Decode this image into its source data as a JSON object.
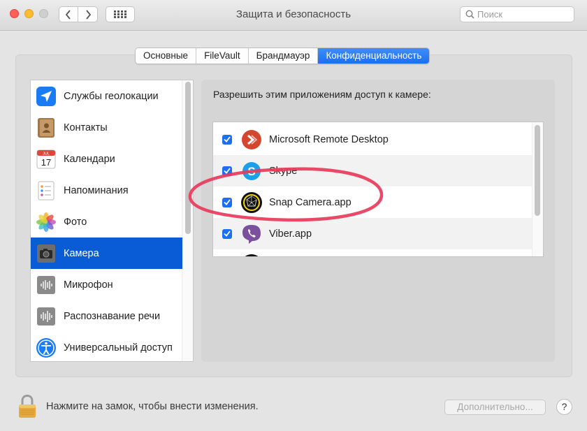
{
  "window": {
    "title": "Защита и безопасность"
  },
  "search": {
    "placeholder": "Поиск"
  },
  "tabs": [
    {
      "label": "Основные",
      "active": false
    },
    {
      "label": "FileVault",
      "active": false
    },
    {
      "label": "Брандмауэр",
      "active": false
    },
    {
      "label": "Конфиденциальность",
      "active": true
    }
  ],
  "sidebar": {
    "items": [
      {
        "label": "Службы геолокации",
        "icon": "location-icon"
      },
      {
        "label": "Контакты",
        "icon": "contacts-icon"
      },
      {
        "label": "Календари",
        "icon": "calendar-icon"
      },
      {
        "label": "Напоминания",
        "icon": "reminders-icon"
      },
      {
        "label": "Фото",
        "icon": "photos-icon"
      },
      {
        "label": "Камера",
        "icon": "camera-icon",
        "selected": true
      },
      {
        "label": "Микрофон",
        "icon": "microphone-icon"
      },
      {
        "label": "Распознавание речи",
        "icon": "speech-recognition-icon"
      },
      {
        "label": "Универсальный доступ",
        "icon": "accessibility-icon"
      }
    ],
    "calendar_day": "17",
    "calendar_month": "JUL"
  },
  "main": {
    "prompt": "Разрешить этим приложениям доступ к камере:",
    "apps": [
      {
        "label": "Microsoft Remote Desktop",
        "checked": true,
        "icon": "remote-desktop-icon"
      },
      {
        "label": "Skype",
        "checked": true,
        "icon": "skype-icon"
      },
      {
        "label": "Snap Camera.app",
        "checked": true,
        "icon": "snap-camera-icon"
      },
      {
        "label": "Viber.app",
        "checked": true,
        "icon": "viber-icon"
      }
    ]
  },
  "footer": {
    "lock_text": "Нажмите на замок, чтобы внести изменения.",
    "advanced_label": "Дополнительно...",
    "help_label": "?"
  },
  "colors": {
    "accent": "#1c6ff0",
    "selection": "#0a5cd6",
    "annotation": "#e8395a"
  }
}
